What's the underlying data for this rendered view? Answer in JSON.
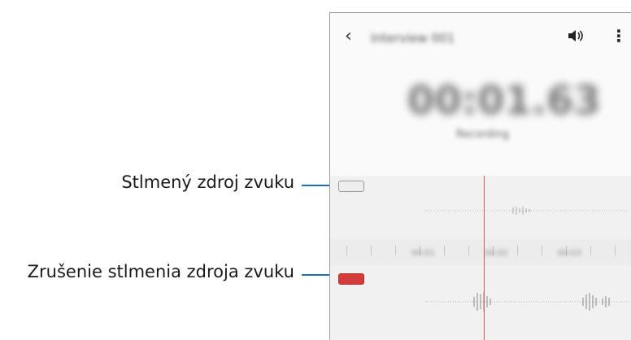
{
  "callouts": {
    "muted_source": "Stlmený zdroj zvuku",
    "unmute_source": "Zrušenie stlmenia zdroja zvuku"
  },
  "phone": {
    "appbar": {
      "back_icon": "chevron-left-icon",
      "title": "Interview 001",
      "volume_icon": "speaker-icon",
      "more_icon": "more-vert-icon"
    },
    "player": {
      "time": "00:01.63",
      "subtitle": "Recording"
    },
    "timeline": {
      "ticks": [
        "00:01",
        "00:02",
        "00:03"
      ]
    },
    "tracks": [
      {
        "name": "track-muted",
        "muted": true,
        "button_color": "#e6e6e6"
      },
      {
        "name": "track-unmuted",
        "muted": false,
        "button_color": "#d33a3a"
      }
    ],
    "accent": "#e05a5a"
  }
}
